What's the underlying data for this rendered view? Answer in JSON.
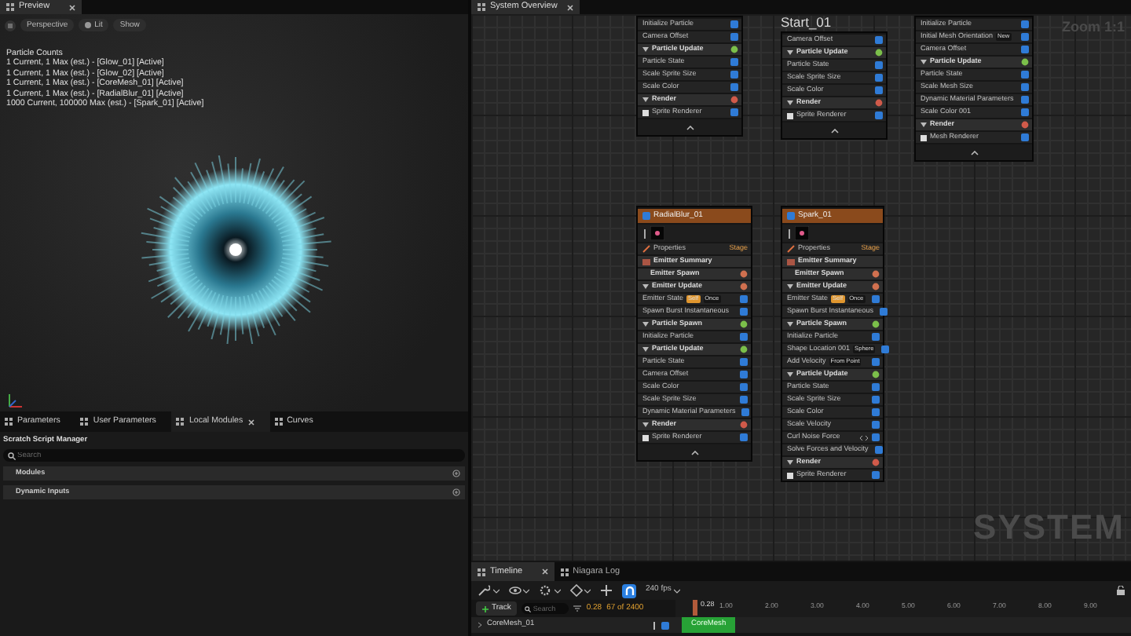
{
  "preview": {
    "tab": {
      "label": "Preview",
      "closable": true
    },
    "toolbar": [
      "Perspective",
      "Lit",
      "Show"
    ],
    "stats_title": "Particle Counts",
    "stats": [
      "1 Current, 1 Max (est.) - [Glow_01] [Active]",
      "1 Current, 1 Max (est.) - [Glow_02] [Active]",
      "1 Current, 1 Max (est.) - [CoreMesh_01] [Active]",
      "1 Current, 1 Max (est.) - [RadialBlur_01] [Active]",
      "1000 Current, 100000 Max (est.) - [Spark_01] [Active]"
    ]
  },
  "left_tabs": [
    {
      "label": "Parameters",
      "selected": false,
      "closable": false
    },
    {
      "label": "User Parameters",
      "selected": false,
      "closable": false
    },
    {
      "label": "Local Modules",
      "selected": true,
      "closable": true
    },
    {
      "label": "Curves",
      "selected": false,
      "closable": false
    }
  ],
  "scratch": {
    "title": "Scratch Script Manager",
    "search_placeholder": "Search",
    "sections": [
      "Modules",
      "Dynamic Inputs"
    ]
  },
  "graph": {
    "tab": {
      "label": "System Overview",
      "closable": true
    },
    "zoom_label": "Zoom 1:1",
    "system_label": "SYSTEM",
    "emitter_label": "Start_01",
    "nodes": [
      {
        "items": [
          {
            "kind": "module",
            "text": "Initialize Particle",
            "checked": true
          },
          {
            "kind": "module",
            "text": "Camera Offset",
            "checked": true
          },
          {
            "kind": "section",
            "text": "Particle Update",
            "color": "#7bbf4a",
            "expanded": true
          },
          {
            "kind": "module",
            "text": "Particle State",
            "checked": true
          },
          {
            "kind": "module",
            "text": "Scale Sprite Size",
            "checked": true
          },
          {
            "kind": "module",
            "text": "Scale Color",
            "checked": true
          },
          {
            "kind": "section",
            "text": "Render",
            "color": "#d05a4a",
            "expanded": true
          },
          {
            "kind": "renderer",
            "text": "Sprite Renderer",
            "checked": true
          },
          {
            "kind": "collapse"
          }
        ]
      },
      {
        "items": [
          {
            "kind": "module",
            "text": "Camera Offset",
            "checked": true
          },
          {
            "kind": "section",
            "text": "Particle Update",
            "color": "#7bbf4a",
            "expanded": true
          },
          {
            "kind": "module",
            "text": "Particle State",
            "checked": true
          },
          {
            "kind": "module",
            "text": "Scale Sprite Size",
            "checked": true
          },
          {
            "kind": "module",
            "text": "Scale Color",
            "checked": true
          },
          {
            "kind": "section",
            "text": "Render",
            "color": "#d05a4a",
            "expanded": true
          },
          {
            "kind": "renderer",
            "text": "Sprite Renderer",
            "checked": true
          },
          {
            "kind": "collapse"
          }
        ]
      },
      {
        "items": [
          {
            "kind": "module",
            "text": "Initialize Particle",
            "checked": true
          },
          {
            "kind": "module",
            "text": "Initial Mesh Orientation",
            "checked": true,
            "tags": [
              {
                "text": "New",
                "color": "#151515"
              }
            ]
          },
          {
            "kind": "module",
            "text": "Camera Offset",
            "checked": true
          },
          {
            "kind": "section",
            "text": "Particle Update",
            "color": "#7bbf4a",
            "expanded": true
          },
          {
            "kind": "module",
            "text": "Particle State",
            "checked": true
          },
          {
            "kind": "module",
            "text": "Scale Mesh Size",
            "checked": true
          },
          {
            "kind": "module",
            "text": "Dynamic Material Parameters",
            "checked": true
          },
          {
            "kind": "module",
            "text": "Scale Color 001",
            "checked": true
          },
          {
            "kind": "section",
            "text": "Render",
            "color": "#d05a4a",
            "expanded": true
          },
          {
            "kind": "renderer",
            "text": "Mesh Renderer",
            "checked": true
          },
          {
            "kind": "collapse"
          }
        ]
      },
      {
        "items": [
          {
            "kind": "title",
            "text": "RadialBlur_01",
            "checked": true
          },
          {
            "kind": "thumb"
          },
          {
            "kind": "props",
            "text": "Properties",
            "stage": "Stage"
          },
          {
            "kind": "summary",
            "text": "Emitter Summary"
          },
          {
            "kind": "section",
            "text": "Emitter Spawn",
            "color": "#d0704f",
            "expanded": false
          },
          {
            "kind": "section",
            "text": "Emitter Update",
            "color": "#d0704f",
            "expanded": true
          },
          {
            "kind": "module",
            "text": "Emitter State",
            "checked": true,
            "tags": [
              {
                "text": "Self",
                "color": "#e0962e"
              },
              {
                "text": "Once",
                "color": "#151515"
              }
            ]
          },
          {
            "kind": "module",
            "text": "Spawn Burst Instantaneous",
            "checked": true
          },
          {
            "kind": "section",
            "text": "Particle Spawn",
            "color": "#7bbf4a",
            "expanded": true
          },
          {
            "kind": "module",
            "text": "Initialize Particle",
            "checked": true
          },
          {
            "kind": "section",
            "text": "Particle Update",
            "color": "#7bbf4a",
            "expanded": true
          },
          {
            "kind": "module",
            "text": "Particle State",
            "checked": true
          },
          {
            "kind": "module",
            "text": "Camera Offset",
            "checked": true
          },
          {
            "kind": "module",
            "text": "Scale Color",
            "checked": true
          },
          {
            "kind": "module",
            "text": "Scale Sprite Size",
            "checked": true
          },
          {
            "kind": "module",
            "text": "Dynamic Material Parameters",
            "checked": true
          },
          {
            "kind": "section",
            "text": "Render",
            "color": "#d05a4a",
            "expanded": true
          },
          {
            "kind": "renderer",
            "text": "Sprite Renderer",
            "checked": true
          },
          {
            "kind": "collapse"
          }
        ]
      },
      {
        "items": [
          {
            "kind": "title",
            "text": "Spark_01",
            "checked": true
          },
          {
            "kind": "thumb"
          },
          {
            "kind": "props",
            "text": "Properties",
            "stage": "Stage"
          },
          {
            "kind": "summary",
            "text": "Emitter Summary"
          },
          {
            "kind": "section",
            "text": "Emitter Spawn",
            "color": "#d0704f",
            "expanded": false
          },
          {
            "kind": "section",
            "text": "Emitter Update",
            "color": "#d0704f",
            "expanded": true
          },
          {
            "kind": "module",
            "text": "Emitter State",
            "checked": true,
            "tags": [
              {
                "text": "Self",
                "color": "#e0962e"
              },
              {
                "text": "Once",
                "color": "#151515"
              }
            ]
          },
          {
            "kind": "module",
            "text": "Spawn Burst Instantaneous",
            "checked": true
          },
          {
            "kind": "section",
            "text": "Particle Spawn",
            "color": "#7bbf4a",
            "expanded": true
          },
          {
            "kind": "module",
            "text": "Initialize Particle",
            "checked": true
          },
          {
            "kind": "module",
            "text": "Shape Location 001",
            "checked": true,
            "tags": [
              {
                "text": "Sphere",
                "color": "#151515"
              }
            ]
          },
          {
            "kind": "module",
            "text": "Add Velocity",
            "checked": true,
            "tags": [
              {
                "text": "From Point",
                "color": "#151515"
              }
            ]
          },
          {
            "kind": "section",
            "text": "Particle Update",
            "color": "#7bbf4a",
            "expanded": true
          },
          {
            "kind": "module",
            "text": "Particle State",
            "checked": true
          },
          {
            "kind": "module",
            "text": "Scale Sprite Size",
            "checked": true
          },
          {
            "kind": "module",
            "text": "Scale Color",
            "checked": true
          },
          {
            "kind": "module",
            "text": "Scale Velocity",
            "checked": true
          },
          {
            "kind": "module",
            "text": "Curl Noise Force",
            "checked": true,
            "scratch": true
          },
          {
            "kind": "module",
            "text": "Solve Forces and Velocity",
            "checked": true
          },
          {
            "kind": "section",
            "text": "Render",
            "color": "#d05a4a",
            "expanded": true
          },
          {
            "kind": "renderer",
            "text": "Sprite Renderer",
            "checked": true
          }
        ]
      }
    ]
  },
  "timeline": {
    "tabs": [
      {
        "label": "Timeline",
        "selected": true,
        "closable": true
      },
      {
        "label": "Niagara Log",
        "selected": false,
        "closable": false
      }
    ],
    "snap_on": true,
    "fps": "240 fps",
    "add_track": "Track",
    "search_placeholder": "Search",
    "time": "0.28",
    "frame": "67 of 2400",
    "playhead": "0.28",
    "ticks": [
      "1.00",
      "2.00",
      "3.00",
      "4.00",
      "5.00",
      "6.00",
      "7.00",
      "8.00",
      "9.00"
    ],
    "tracks": [
      {
        "name": "CoreMesh_01",
        "checked": true,
        "clip": "CoreMesh"
      }
    ]
  }
}
